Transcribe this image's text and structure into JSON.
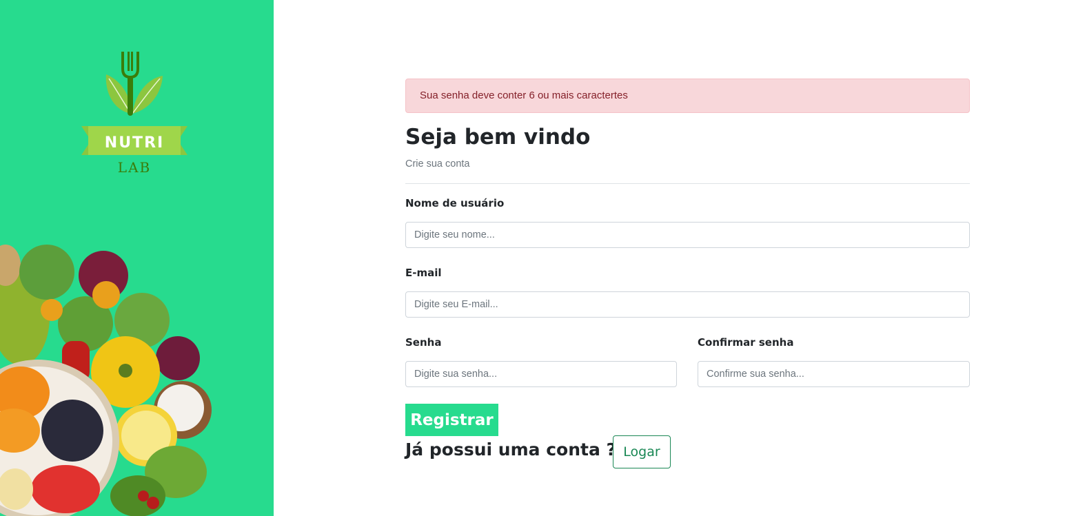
{
  "brand": {
    "logo_line1": "NUTRI",
    "logo_line2": "LAB",
    "logo_icon": "fork-leaf-icon",
    "accent_color": "#27db8e"
  },
  "alert": {
    "message": "Sua senha deve conter 6 ou mais caractertes"
  },
  "header": {
    "title": "Seja bem vindo",
    "subtitle": "Crie sua conta"
  },
  "form": {
    "username": {
      "label": "Nome de usuário",
      "placeholder": "Digite seu nome..."
    },
    "email": {
      "label": "E-mail",
      "placeholder": "Digite seu E-mail..."
    },
    "password": {
      "label": "Senha",
      "placeholder": "Digite sua senha..."
    },
    "confirm_password": {
      "label": "Confirmar senha",
      "placeholder": "Confirme sua senha..."
    },
    "register_label": "Registrar"
  },
  "footer": {
    "account_question": "Já possui uma conta ?",
    "login_label": "Logar"
  }
}
